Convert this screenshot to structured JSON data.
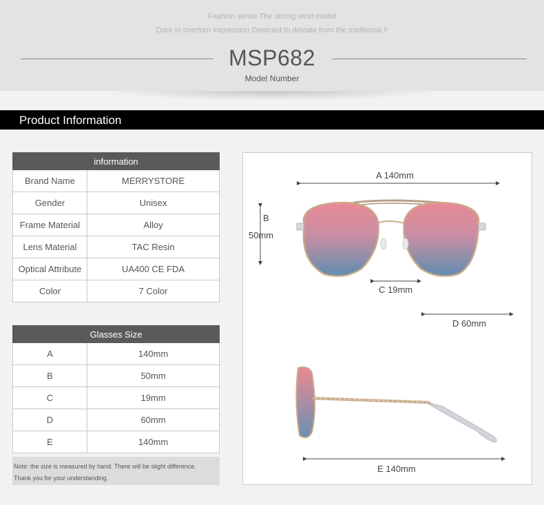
{
  "header": {
    "tagline_1": "Fashion sense The strong wind model",
    "tagline_2": "Dare to overturn impression Destined to deviate from the traditional !!",
    "model_number": "MSP682",
    "model_label": "Model Number"
  },
  "section": {
    "title": "Product Information"
  },
  "info_table": {
    "heading": "information",
    "rows": [
      {
        "key": "Brand Name",
        "value": "MERRYSTORE"
      },
      {
        "key": "Gender",
        "value": "Unisex"
      },
      {
        "key": "Frame Material",
        "value": "Alloy"
      },
      {
        "key": "Lens Material",
        "value": "TAC Resin"
      },
      {
        "key": "Optical Attribute",
        "value": "UA400 CE FDA"
      },
      {
        "key": "Color",
        "value": "7 Color"
      }
    ]
  },
  "size_table": {
    "heading": "Glasses Size",
    "rows": [
      {
        "key": "A",
        "value": "140mm"
      },
      {
        "key": "B",
        "value": "50mm"
      },
      {
        "key": "C",
        "value": "19mm"
      },
      {
        "key": "D",
        "value": "60mm"
      },
      {
        "key": "E",
        "value": "140mm"
      }
    ]
  },
  "note": {
    "line_1": "Note: the size is measured by hand. There will be slight difference.",
    "line_2": "Thank you for your understanding."
  },
  "diagram": {
    "label_a": "A 140mm",
    "label_b_letter": "B",
    "label_b_value": "50mm",
    "label_c": "C 19mm",
    "label_d": "D 60mm",
    "label_e": "E 140mm",
    "lens_colors": {
      "top": "#e98a93",
      "bottom": "#5f8db0"
    },
    "frame_color": "#c9a98a"
  }
}
